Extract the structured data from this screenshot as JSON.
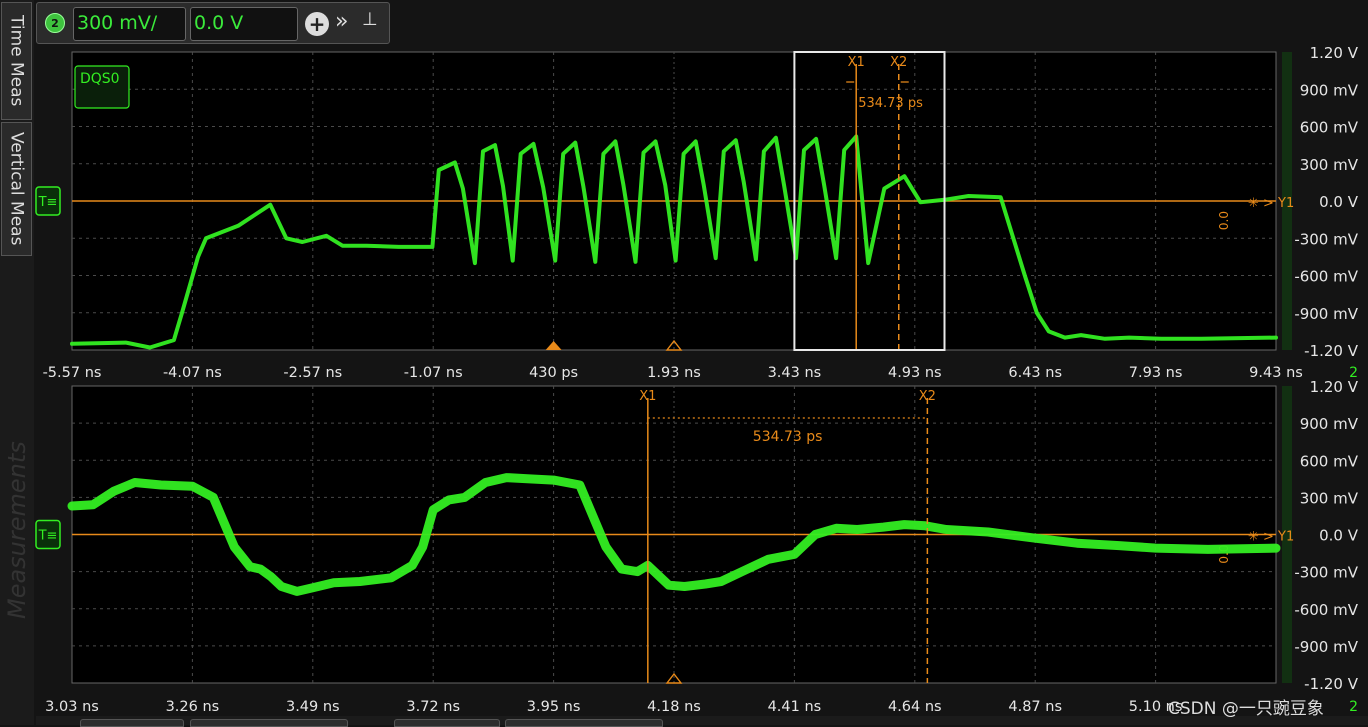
{
  "sidebar": {
    "tabs": [
      "Time Meas",
      "Vertical Meas"
    ],
    "panel_label": "Measurements"
  },
  "channel_control": {
    "channel_number": "2",
    "scale": "300 mV/",
    "offset": "0.0 V"
  },
  "colors": {
    "trace": "#33ee22",
    "cursor": "#e88a1a",
    "grid": "#4a4a4a",
    "scale_bar": "#123012"
  },
  "watermark": "CSDN @一只豌豆象",
  "chart_data": [
    {
      "type": "line",
      "label": "DQS0",
      "channel_marker": "2",
      "x_ticks": [
        "-5.57 ns",
        "-4.07 ns",
        "-2.57 ns",
        "-1.07 ns",
        "430 ps",
        "1.93 ns",
        "3.43 ns",
        "4.93 ns",
        "6.43 ns",
        "7.93 ns",
        "9.43 ns"
      ],
      "y_ticks": [
        "1.20 V",
        "900 mV",
        "600 mV",
        "300 mV",
        "0.0 V",
        "-300 mV",
        "-600 mV",
        "-900 mV",
        "-1.20 V"
      ],
      "xlim_ns": [
        -5.57,
        9.43
      ],
      "ylim_mV": [
        -1200,
        1200
      ],
      "series": [
        {
          "name": "DQS0",
          "x_ns": [
            -5.57,
            -4.9,
            -4.6,
            -4.3,
            -4.2,
            -4.0,
            -3.9,
            -3.5,
            -3.1,
            -2.9,
            -2.7,
            -2.4,
            -2.2,
            -1.9,
            -1.5,
            -1.08,
            -1.0,
            -0.8,
            -0.7,
            -0.55,
            -0.45,
            -0.3,
            -0.2,
            -0.08,
            0.02,
            0.18,
            0.3,
            0.45,
            0.55,
            0.7,
            0.8,
            0.95,
            1.05,
            1.2,
            1.3,
            1.45,
            1.55,
            1.7,
            1.82,
            1.95,
            2.05,
            2.2,
            2.3,
            2.45,
            2.55,
            2.7,
            2.8,
            2.95,
            3.05,
            3.2,
            3.3,
            3.45,
            3.55,
            3.7,
            3.8,
            3.95,
            4.05,
            4.2,
            4.35,
            4.55,
            4.8,
            5.0,
            5.3,
            5.6,
            6.0,
            6.3,
            6.45,
            6.6,
            6.8,
            7.0,
            7.3,
            7.6,
            8.0,
            8.5,
            9.43
          ],
          "y_mV": [
            -1150,
            -1140,
            -1180,
            -1120,
            -900,
            -450,
            -300,
            -200,
            -30,
            -300,
            -330,
            -280,
            -360,
            -360,
            -370,
            -370,
            250,
            310,
            100,
            -500,
            400,
            450,
            120,
            -480,
            380,
            460,
            110,
            -480,
            380,
            470,
            120,
            -490,
            380,
            480,
            130,
            -490,
            390,
            480,
            130,
            -480,
            380,
            480,
            130,
            -460,
            400,
            490,
            150,
            -470,
            400,
            510,
            130,
            -460,
            410,
            500,
            130,
            -460,
            410,
            520,
            -500,
            100,
            200,
            -10,
            10,
            40,
            30,
            -600,
            -900,
            -1050,
            -1100,
            -1080,
            -1110,
            -1100,
            -1110,
            -1110,
            -1100
          ]
        }
      ],
      "cursors": {
        "x1": {
          "label": "X1",
          "x_ns": 4.2
        },
        "x2": {
          "label": "X2",
          "x_ns": 4.73
        },
        "delta_text": "534.73 ps",
        "y1": {
          "label": "Y1",
          "value_text": "0.0"
        }
      },
      "zoom_box_ns": [
        3.43,
        5.3
      ],
      "trigger_marker_ns": 0.43,
      "time_ref_ns": 1.93
    },
    {
      "type": "line",
      "channel_marker": "2",
      "x_ticks": [
        "3.03 ns",
        "3.26 ns",
        "3.49 ns",
        "3.72 ns",
        "3.95 ns",
        "4.18 ns",
        "4.41 ns",
        "4.64 ns",
        "4.87 ns",
        "5.10 ns"
      ],
      "y_ticks": [
        "1.20 V",
        "900 mV",
        "600 mV",
        "300 mV",
        "0.0 V",
        "-300 mV",
        "-600 mV",
        "-900 mV",
        "-1.20 V"
      ],
      "xlim_ns": [
        3.03,
        5.33
      ],
      "ylim_mV": [
        -1200,
        1200
      ],
      "series": [
        {
          "name": "DQS0",
          "x_ns": [
            3.03,
            3.07,
            3.11,
            3.15,
            3.2,
            3.26,
            3.3,
            3.34,
            3.37,
            3.39,
            3.41,
            3.43,
            3.46,
            3.49,
            3.53,
            3.58,
            3.64,
            3.68,
            3.7,
            3.72,
            3.75,
            3.78,
            3.82,
            3.86,
            3.9,
            3.95,
            4.0,
            4.05,
            4.08,
            4.11,
            4.13,
            4.15,
            4.17,
            4.2,
            4.24,
            4.27,
            4.31,
            4.36,
            4.41,
            4.45,
            4.49,
            4.53,
            4.58,
            4.62,
            4.66,
            4.7,
            4.78,
            4.87,
            4.95,
            5.03,
            5.1,
            5.2,
            5.33
          ],
          "y_mV": [
            230,
            240,
            350,
            420,
            400,
            390,
            300,
            -100,
            -260,
            -280,
            -340,
            -420,
            -460,
            -430,
            -390,
            -380,
            -350,
            -250,
            -100,
            200,
            280,
            300,
            420,
            460,
            450,
            440,
            400,
            -100,
            -280,
            -300,
            -250,
            -330,
            -410,
            -420,
            -400,
            -380,
            -300,
            -200,
            -160,
            0,
            50,
            40,
            60,
            80,
            70,
            40,
            20,
            -30,
            -70,
            -90,
            -110,
            -120,
            -110
          ]
        }
      ],
      "cursors": {
        "x1": {
          "label": "X1",
          "x_ns": 4.13
        },
        "x2": {
          "label": "X2",
          "x_ns": 4.664
        },
        "delta_text": "534.73 ps",
        "y1": {
          "label": "Y1",
          "value_text": "0.0"
        }
      },
      "trigger_marker_ns": 4.18
    }
  ]
}
